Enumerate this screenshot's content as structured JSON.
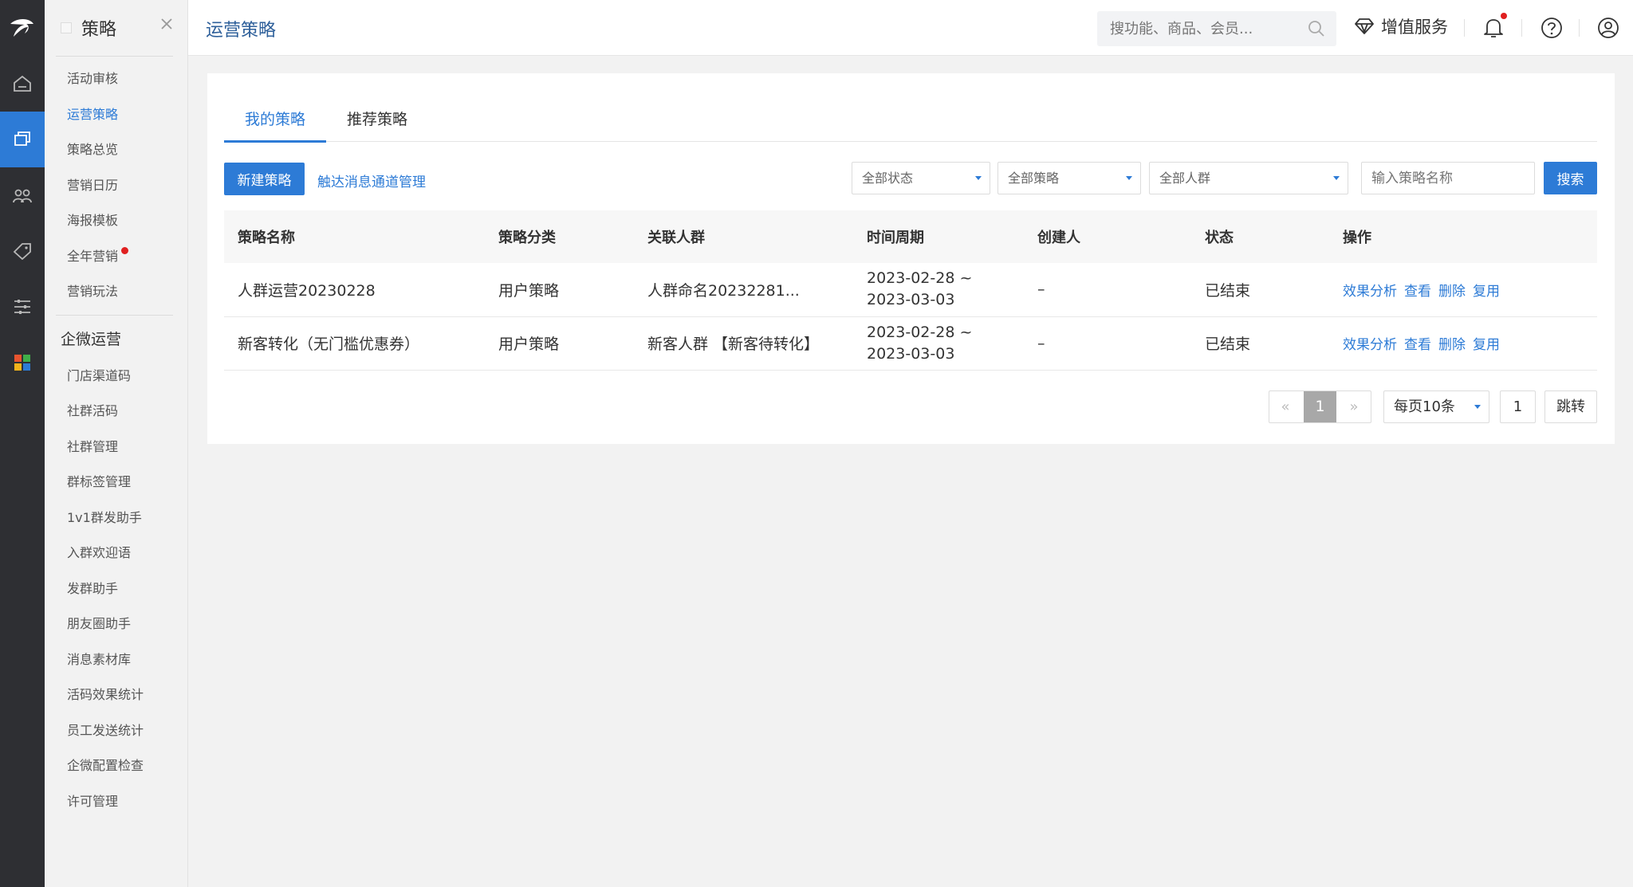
{
  "sidebar": {
    "title": "策略",
    "items": [
      {
        "label": "活动审核"
      },
      {
        "label": "运营策略"
      },
      {
        "label": "策略总览"
      },
      {
        "label": "营销日历"
      },
      {
        "label": "海报模板"
      },
      {
        "label": "全年营销"
      },
      {
        "label": "营销玩法"
      }
    ],
    "group_label": "企微运营",
    "group_items": [
      {
        "label": "门店渠道码"
      },
      {
        "label": "社群活码"
      },
      {
        "label": "社群管理"
      },
      {
        "label": "群标签管理"
      },
      {
        "label": "1v1群发助手"
      },
      {
        "label": "入群欢迎语"
      },
      {
        "label": "发群助手"
      },
      {
        "label": "朋友圈助手"
      },
      {
        "label": "消息素材库"
      },
      {
        "label": "活码效果统计"
      },
      {
        "label": "员工发送统计"
      },
      {
        "label": "企微配置检查"
      },
      {
        "label": "许可管理"
      }
    ]
  },
  "header": {
    "title": "运营策略",
    "search_placeholder": "搜功能、商品、会员...",
    "value_added_label": "增值服务"
  },
  "tabs": [
    {
      "label": "我的策略"
    },
    {
      "label": "推荐策略"
    }
  ],
  "toolbar": {
    "new_label": "新建策略",
    "channel_link": "触达消息通道管理",
    "status_filter": "全部状态",
    "strategy_filter": "全部策略",
    "crowd_filter": "全部人群",
    "name_placeholder": "输入策略名称",
    "search_label": "搜索"
  },
  "table": {
    "headers": [
      "策略名称",
      "策略分类",
      "关联人群",
      "时间周期",
      "创建人",
      "状态",
      "操作"
    ],
    "rows": [
      {
        "name": "人群运营20230228",
        "category": "用户策略",
        "crowd": "人群命名20232281...",
        "period_start": "2023-02-28 ~",
        "period_end": "2023-03-03",
        "creator": "–",
        "status": "已结束"
      },
      {
        "name": "新客转化（无门槛优惠券）",
        "category": "用户策略",
        "crowd": "新客人群 【新客待转化】",
        "period_start": "2023-02-28 ~",
        "period_end": "2023-03-03",
        "creator": "–",
        "status": "已结束"
      }
    ],
    "actions": [
      "效果分析",
      "查看",
      "删除",
      "复用"
    ]
  },
  "pagination": {
    "prev": "«",
    "current": "1",
    "next": "»",
    "page_size": "每页10条",
    "jump_value": "1",
    "jump_label": "跳转"
  },
  "colors": {
    "accent": "#2d7bd6",
    "rail": "#2e2f33",
    "badge": "#e02020"
  }
}
